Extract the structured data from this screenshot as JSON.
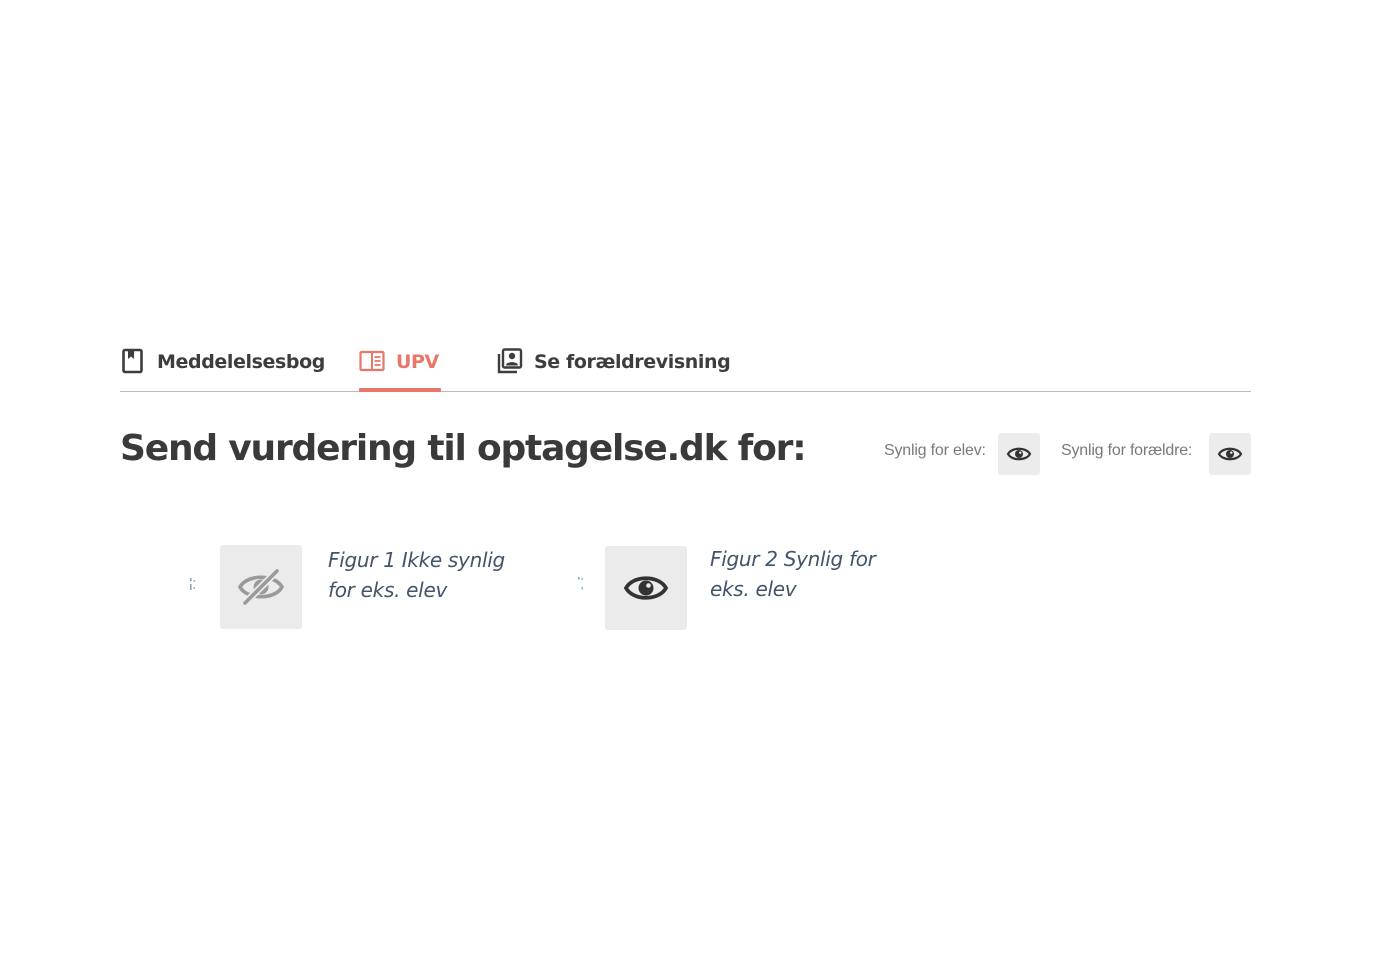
{
  "tabs": [
    {
      "label": "Meddelelsesbog",
      "icon": "bookmark-book-icon",
      "active": false
    },
    {
      "label": "UPV",
      "icon": "book-open-icon",
      "active": true
    },
    {
      "label": "Se forældrevisning",
      "icon": "contact-photos-icon",
      "active": false
    }
  ],
  "heading": {
    "title": "Send vurdering til optagelse.dk for:"
  },
  "visibility": {
    "student_label": "Synlig for elev:",
    "student_icon": "eye-icon",
    "parents_label": "Synlig for forældre:",
    "parents_icon": "eye-icon"
  },
  "figures": [
    {
      "caption_line1": "Figur 1 Ikke synlig",
      "caption_line2": "for eks. elev",
      "icon": "eye-off-icon"
    },
    {
      "caption_line1": "Figur 2 Synlig for",
      "caption_line2": "eks. elev",
      "icon": "eye-icon"
    }
  ],
  "colors": {
    "accent": "#e8766a",
    "text": "#3a3a3a",
    "caption": "#44546a",
    "button_bg": "#ececec"
  }
}
